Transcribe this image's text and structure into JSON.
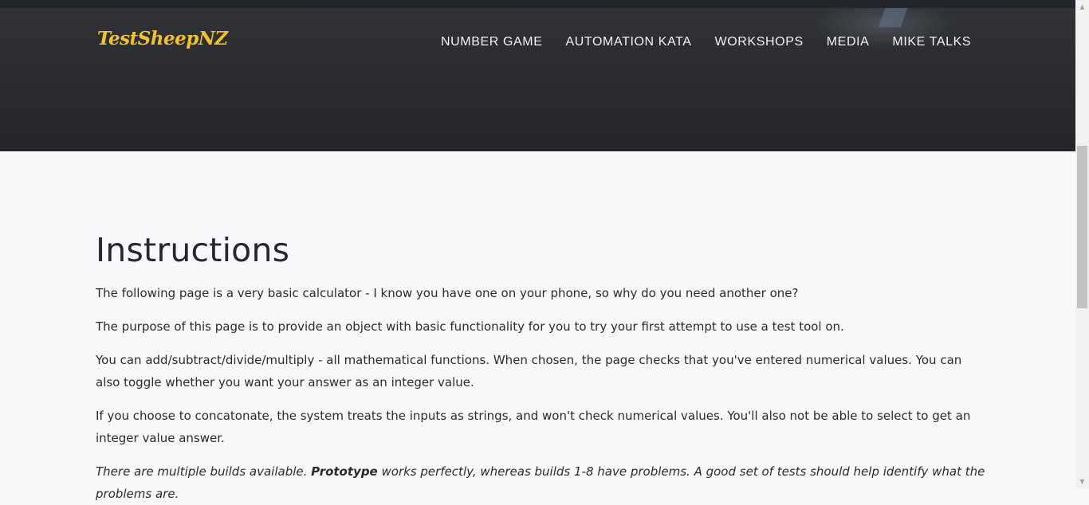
{
  "header": {
    "logo": "TestSheepNZ",
    "nav": [
      {
        "label": "NUMBER GAME"
      },
      {
        "label": "AUTOMATION KATA"
      },
      {
        "label": "WORKSHOPS"
      },
      {
        "label": "MEDIA"
      },
      {
        "label": "MIKE TALKS"
      }
    ]
  },
  "main": {
    "title": "Instructions",
    "paragraphs": [
      "The following page is a very basic calculator - I know you have one on your phone, so why do you need another one?",
      "The purpose of this page is to provide an object with basic functionality for you to try your first attempt to use a test tool on.",
      "You can add/subtract/divide/multiply - all mathematical functions. When chosen, the page checks that you've entered numerical values. You can also toggle whether you want your answer as an integer value.",
      "If you choose to concatonate, the system treats the inputs as strings, and won't check numerical values. You'll also not be able to select to get an integer value answer."
    ],
    "note": {
      "before": "There are multiple builds available. ",
      "bold": "Prototype",
      "after": " works perfectly, whereas builds 1-8 have problems. A good set of tests should help identify what the problems are."
    }
  },
  "colors": {
    "logo": "#f0c130",
    "hero": "#2a2c2f",
    "page_bg": "#f7f8fa"
  }
}
